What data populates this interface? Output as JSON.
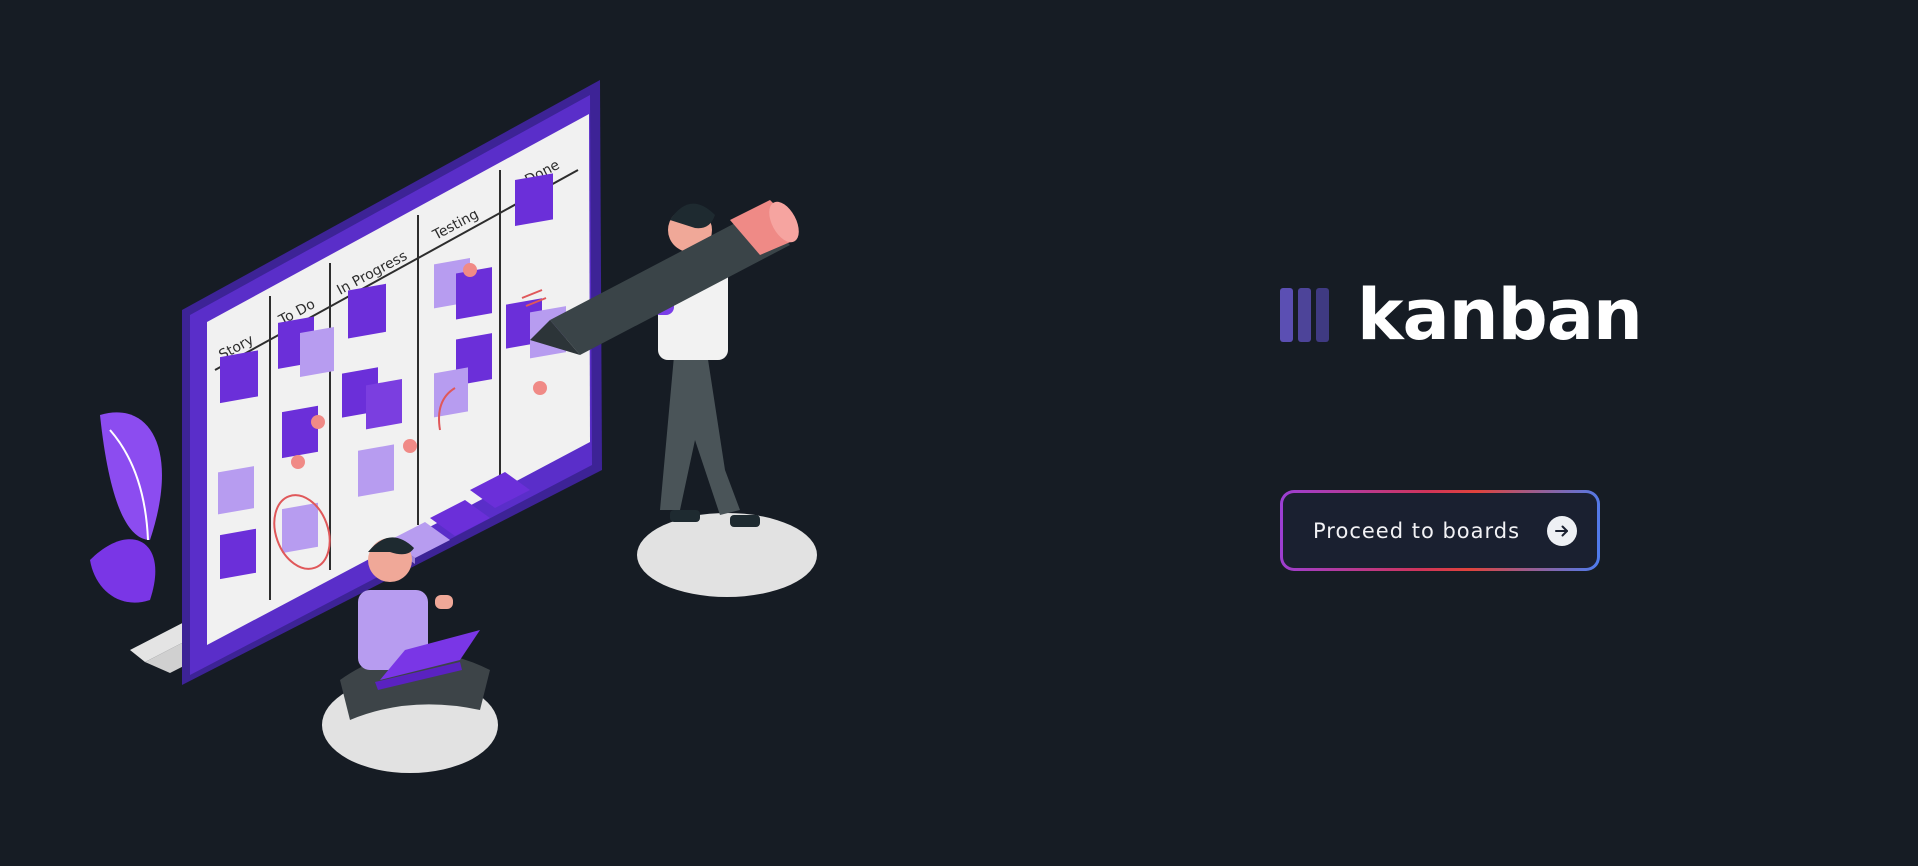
{
  "brand": {
    "title": "kanban",
    "logo_icon": "kanban-columns-icon",
    "logo_colors": [
      "#5b4fb3",
      "#4d4499",
      "#3f3a82"
    ]
  },
  "cta": {
    "label": "Proceed to boards",
    "icon": "arrow-right-circle-icon"
  },
  "illustration": {
    "board_columns": [
      "Story",
      "To Do",
      "In Progress",
      "Testing",
      "Done"
    ]
  },
  "colors": {
    "background": "#161c24",
    "accent_purple": "#6b2fd9",
    "light_purple": "#b79cf0",
    "coral": "#f08a86"
  }
}
